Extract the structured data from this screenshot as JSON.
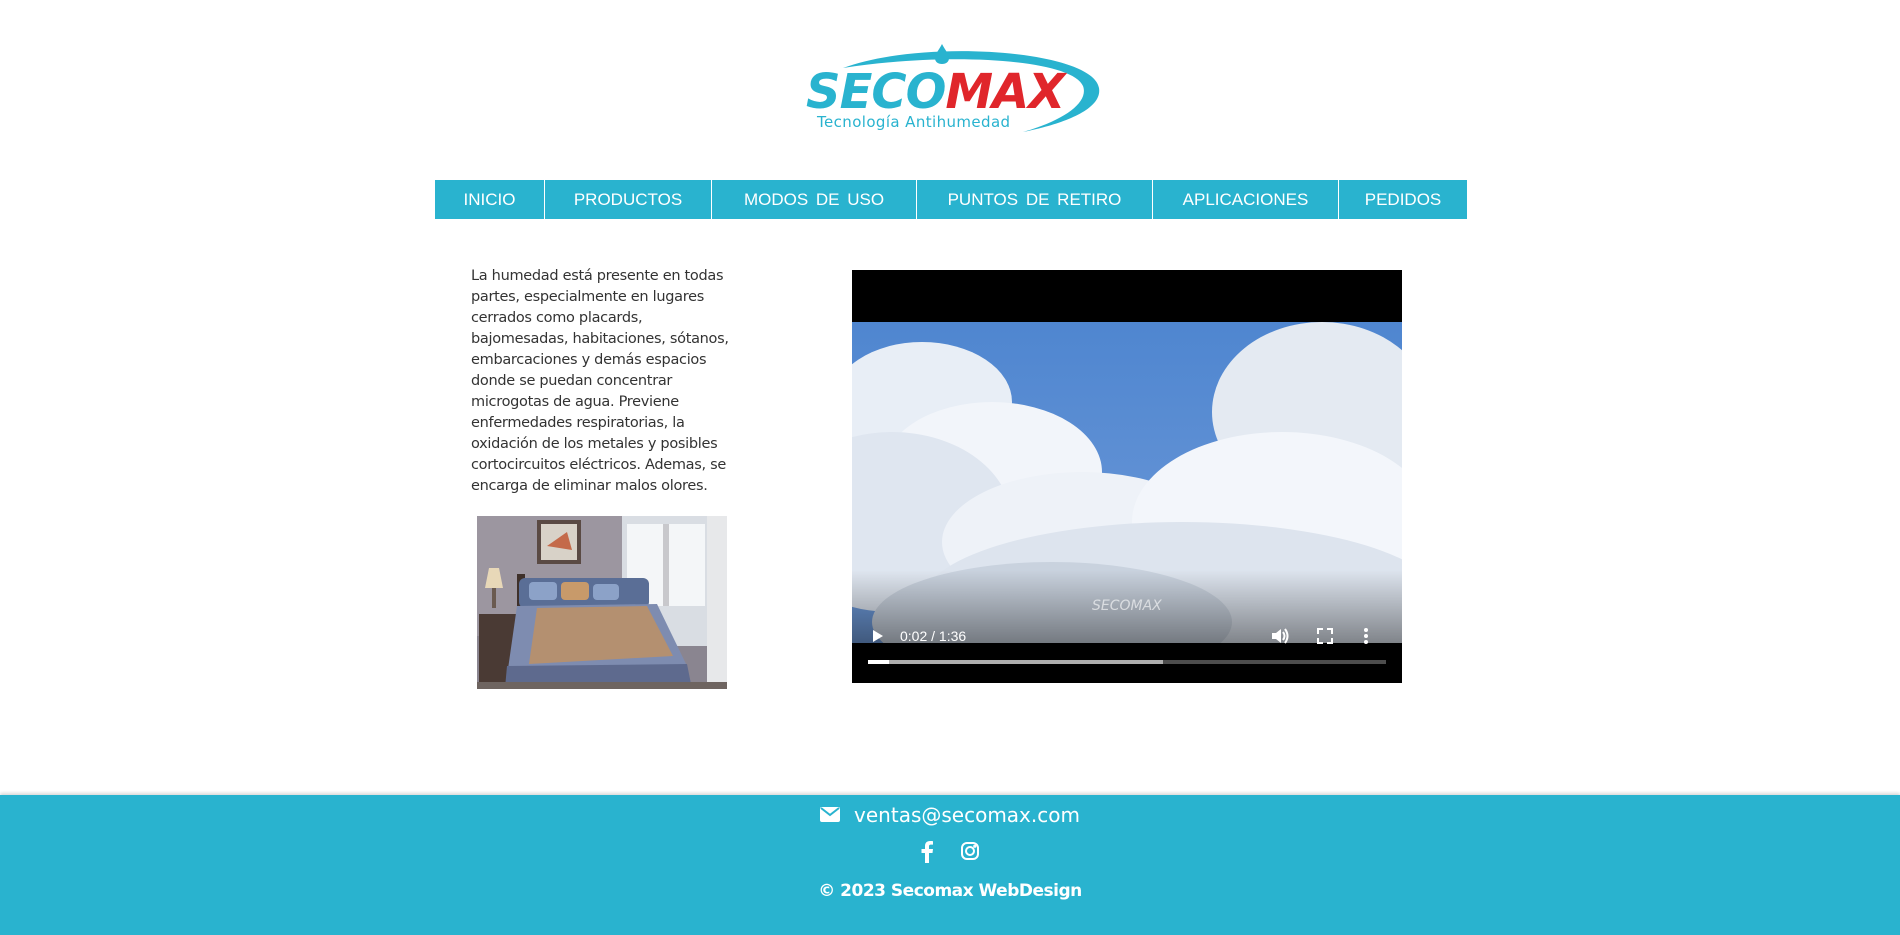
{
  "brand": {
    "name_part1": "SECO",
    "name_part2": "MAX",
    "tagline": "Tecnología Antihumedad",
    "colors": {
      "primary": "#29b3cf",
      "accent": "#e0262b"
    }
  },
  "nav": {
    "items": [
      {
        "label": "INICIO"
      },
      {
        "label": "PRODUCTOS"
      },
      {
        "label": "MODOS DE USO"
      },
      {
        "label": "PUNTOS DE RETIRO"
      },
      {
        "label": "APLICACIONES"
      },
      {
        "label": "PEDIDOS"
      }
    ]
  },
  "main": {
    "intro": "La humedad está presente en todas partes, especialmente en lugares cerrados como placards, bajomesadas, habitaciones, sótanos, embarcaciones y demás espacios donde se puedan concentrar microgotas de agua. Previene enfermedades respiratorias, la oxidación de los metales y posibles cortocircuitos eléctricos. Ademas, se encarga de eliminar malos olores.",
    "image_alt": "bedroom",
    "video": {
      "time": "0:02 / 1:36",
      "watermark": "SECOMAX",
      "played_fraction": 0.04,
      "buffered_fraction": 0.57
    }
  },
  "footer": {
    "email": "ventas@secomax.com",
    "copyright": "© 2023 Secomax WebDesign",
    "icons": [
      "mail-icon",
      "facebook-icon",
      "instagram-icon"
    ]
  }
}
